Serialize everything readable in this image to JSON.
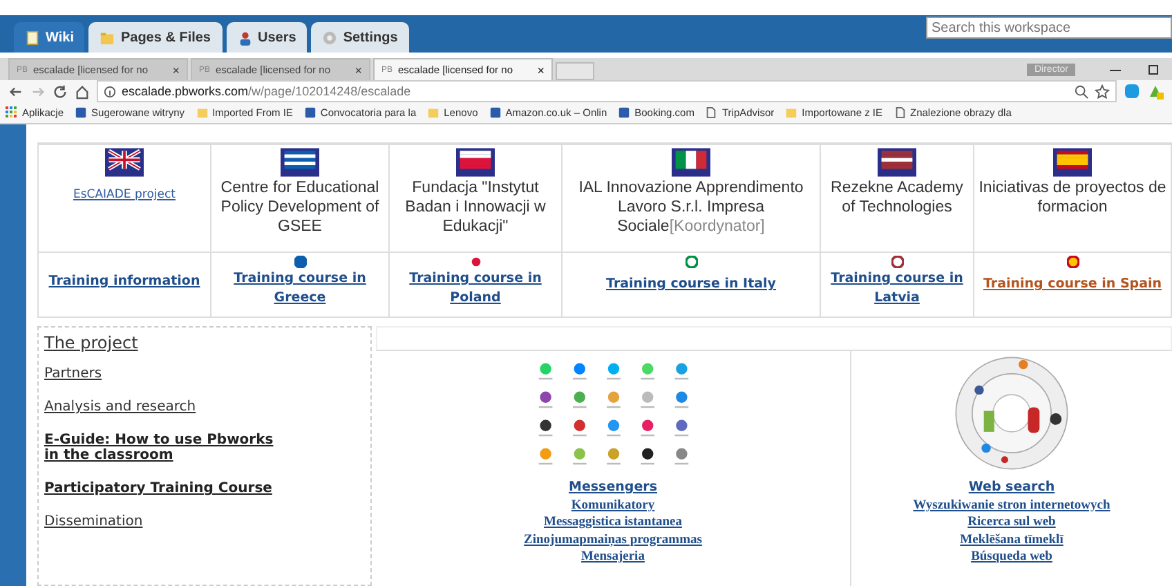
{
  "workspace_bar": {
    "tabs": [
      {
        "label": "Wiki",
        "selected": true
      },
      {
        "label": "Pages & Files",
        "selected": false
      },
      {
        "label": "Users",
        "selected": false
      },
      {
        "label": "Settings",
        "selected": false
      }
    ],
    "search": {
      "placeholder": "Search this workspace"
    }
  },
  "browser": {
    "tabs": [
      {
        "favicon": "PB",
        "title": "escalade [licensed for no",
        "close": "×",
        "selected": false
      },
      {
        "favicon": "PB",
        "title": "escalade [licensed for no",
        "close": "×",
        "selected": false
      },
      {
        "favicon": "PB",
        "title": "escalade [licensed for no",
        "close": "×",
        "selected": true
      }
    ],
    "profile": "Director",
    "address": {
      "host": "escalade.pbworks.com",
      "path": "/w/page/102014248/escalade"
    },
    "bookmarks": [
      {
        "kind": "apps",
        "label": "Aplikacje"
      },
      {
        "kind": "site",
        "label": "Sugerowane witryny"
      },
      {
        "kind": "folder",
        "label": "Imported From IE"
      },
      {
        "kind": "site",
        "label": "Convocatoria para la"
      },
      {
        "kind": "folder",
        "label": "Lenovo"
      },
      {
        "kind": "site",
        "label": "Amazon.co.uk – Onlin"
      },
      {
        "kind": "site",
        "label": "Booking.com"
      },
      {
        "kind": "page",
        "label": "TripAdvisor"
      },
      {
        "kind": "folder",
        "label": "Importowane z IE"
      },
      {
        "kind": "page",
        "label": "Znalezione obrazy dla"
      }
    ]
  },
  "partners": [
    {
      "kind": "link",
      "name": "EsCAIADE project",
      "course": "Training information",
      "color": "#1f4e8c"
    },
    {
      "kind": "text",
      "name": "Centre for Educational Policy Development of GSEE",
      "course": "Training course in Greece",
      "color": "#1f4e8c"
    },
    {
      "kind": "text",
      "name": "Fundacja \"Instytut Badan i Innowacji w Edukacji\"",
      "course": "Training course in Poland",
      "color": "#1f4e8c"
    },
    {
      "kind": "text",
      "name": "IAL Innovazione Apprendimento Lavoro S.r.l. Impresa Sociale",
      "note": "[Koordynator]",
      "course": "Training course in Italy",
      "color": "#1f4e8c"
    },
    {
      "kind": "text",
      "name": "Rezekne Academy of Technologies",
      "course": "Training course in Latvia",
      "color": "#1f4e8c"
    },
    {
      "kind": "text",
      "name": "Iniciativas de proyectos de formacion",
      "course": "Training course in Spain",
      "color": "#b4541e"
    }
  ],
  "sidebar": {
    "items": [
      {
        "kind": "heading",
        "label": "The project"
      },
      {
        "kind": "plain",
        "label": "Partners"
      },
      {
        "kind": "plain",
        "label": "Analysis and research"
      },
      {
        "kind": "bold",
        "label": "E-Guide: How to use Pbworks in the classroom"
      },
      {
        "kind": "bold",
        "label": "Participatory Training Course"
      },
      {
        "kind": "plain",
        "label": "Dissemination"
      }
    ]
  },
  "tiles": [
    {
      "kind": "apps",
      "links": [
        "Messengers",
        "Komunikatory",
        "Messaggistica istantanea",
        "Zinojumapmaiņas programmas",
        "Mensajeria"
      ]
    },
    {
      "kind": "wheel",
      "links": [
        "Web search",
        "Wyszukiwanie stron internetowych",
        "Ricerca sul web",
        "Meklēšana tīmeklī",
        "Búsqueda web"
      ]
    }
  ]
}
